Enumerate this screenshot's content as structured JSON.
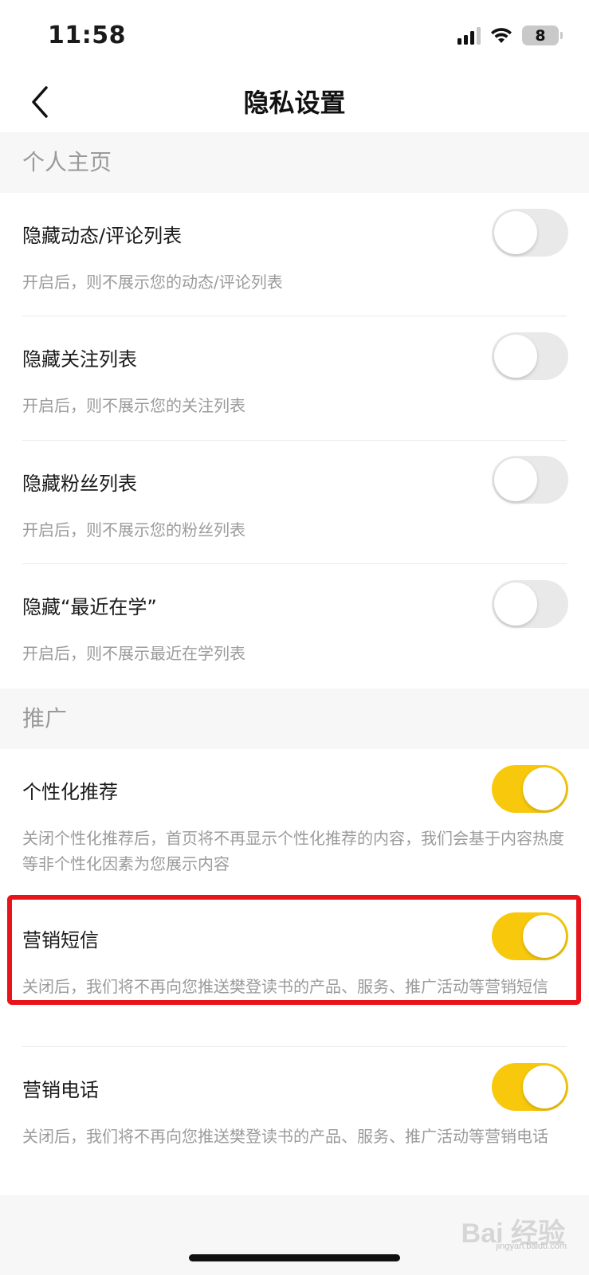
{
  "status_bar": {
    "time": "11:58",
    "battery": "8"
  },
  "nav": {
    "title": "隐私设置"
  },
  "sections": {
    "profile": {
      "header": "个人主页"
    },
    "promotion": {
      "header": "推广"
    }
  },
  "items": {
    "hide_activity": {
      "title": "隐藏动态/评论列表",
      "desc": "开启后，则不展示您的动态/评论列表",
      "enabled": false
    },
    "hide_following": {
      "title": "隐藏关注列表",
      "desc": "开启后，则不展示您的关注列表",
      "enabled": false
    },
    "hide_followers": {
      "title": "隐藏粉丝列表",
      "desc": "开启后，则不展示您的粉丝列表",
      "enabled": false
    },
    "hide_recent": {
      "title": "隐藏“最近在学”",
      "desc": "开启后，则不展示最近在学列表",
      "enabled": false
    },
    "personalized": {
      "title": "个性化推荐",
      "desc": "关闭个性化推荐后，首页将不再显示个性化推荐的内容，我们会基于内容热度等非个性化因素为您展示内容",
      "enabled": true
    },
    "marketing_sms": {
      "title": "营销短信",
      "desc": "关闭后，我们将不再向您推送樊登读书的产品、服务、推广活动等营销短信",
      "enabled": true
    },
    "marketing_phone": {
      "title": "营销电话",
      "desc": "关闭后，我们将不再向您推送樊登读书的产品、服务、推广活动等营销电话",
      "enabled": true
    }
  },
  "colors": {
    "accent": "#f7c80c",
    "highlight": "#e8141b"
  },
  "watermark": {
    "text": "Bai 经验",
    "sub": "jingyan.baidu.com"
  }
}
